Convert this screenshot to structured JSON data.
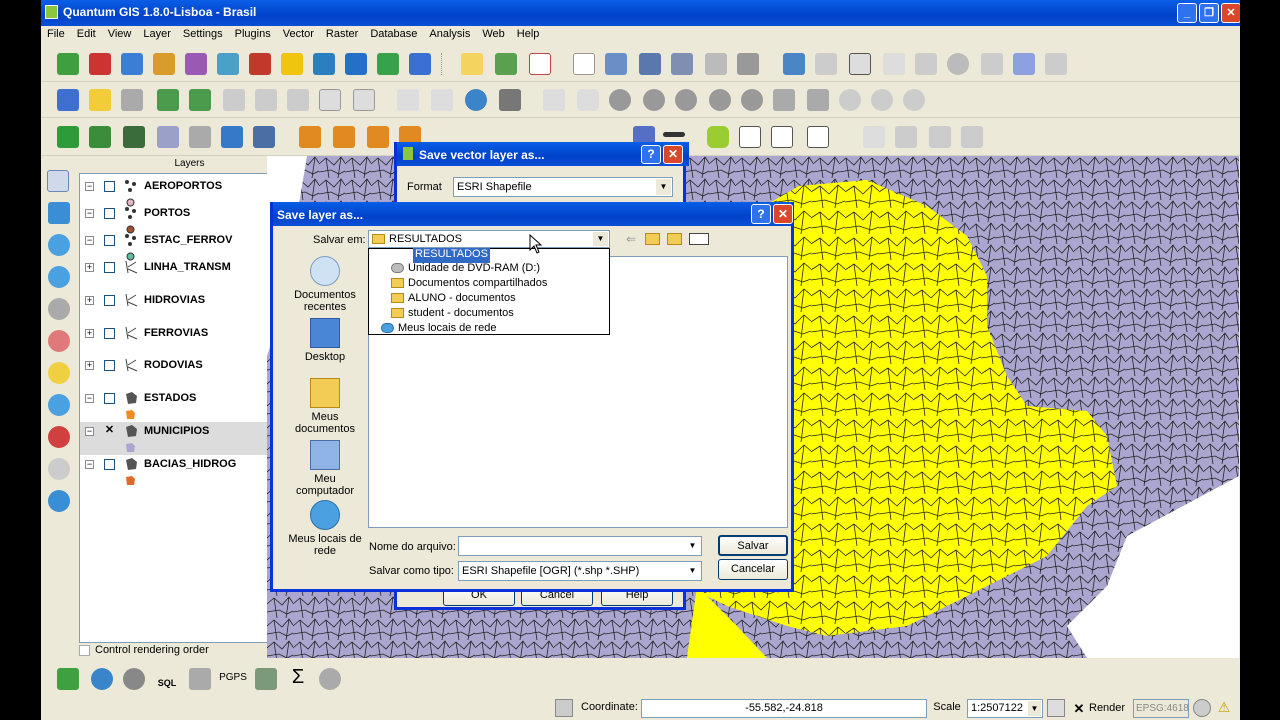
{
  "window": {
    "title": "Quantum GIS 1.8.0-Lisboa - Brasil"
  },
  "menu": [
    "File",
    "Edit",
    "View",
    "Layer",
    "Settings",
    "Plugins",
    "Vector",
    "Raster",
    "Database",
    "Analysis",
    "Web",
    "Help"
  ],
  "layers_panel": {
    "title": "Layers",
    "items": [
      {
        "name": "AEROPORTOS",
        "type": "point",
        "checked": false
      },
      {
        "name": "PORTOS",
        "type": "point",
        "checked": false
      },
      {
        "name": "ESTAC_FERROV",
        "type": "point",
        "checked": false
      },
      {
        "name": "LINHA_TRANSM",
        "type": "line",
        "checked": false
      },
      {
        "name": "HIDROVIAS",
        "type": "line",
        "checked": false
      },
      {
        "name": "FERROVIAS",
        "type": "line",
        "checked": false
      },
      {
        "name": "RODOVIAS",
        "type": "line",
        "checked": false
      },
      {
        "name": "ESTADOS",
        "type": "polygon",
        "checked": false
      },
      {
        "name": "MUNICIPIOS",
        "type": "polygon",
        "checked": true,
        "selected": true
      },
      {
        "name": "BACIAS_HIDROG",
        "type": "polygon",
        "checked": false
      }
    ],
    "control_rendering": "Control rendering order"
  },
  "save_vector_dialog": {
    "title": "Save vector layer as...",
    "format_label": "Format",
    "format_value": "ESRI Shapefile",
    "ok": "OK",
    "cancel": "Cancel",
    "help": "Help"
  },
  "save_layer_dialog": {
    "title": "Save layer as...",
    "save_in_label": "Salvar em:",
    "save_in_value": "RESULTADOS",
    "dropdown": [
      "RESULTADOS",
      "Unidade de DVD-RAM (D:)",
      "Documentos compartilhados",
      "ALUNO - documentos",
      "student - documentos",
      "Meus locais de rede"
    ],
    "places": [
      "Documentos recentes",
      "Desktop",
      "Meus documentos",
      "Meu computador",
      "Meus locais de rede"
    ],
    "filename_label": "Nome do arquivo:",
    "filename_value": "",
    "type_label": "Salvar como tipo:",
    "type_value": "ESRI Shapefile [OGR] (*.shp *.SHP)",
    "save": "Salvar",
    "cancel": "Cancelar"
  },
  "status": {
    "coordinate_label": "Coordinate:",
    "coordinate_value": "-55.582,-24.818",
    "scale_label": "Scale",
    "scale_value": "1:2507122",
    "render_label": "Render",
    "epsg": "EPSG:4618"
  },
  "bottom_tools": [
    "SQL",
    "PGPS"
  ],
  "colors": {
    "map_purple": "#aaa6cf",
    "map_yellow": "#ffff00",
    "xp_blue": "#0a4fd6"
  }
}
